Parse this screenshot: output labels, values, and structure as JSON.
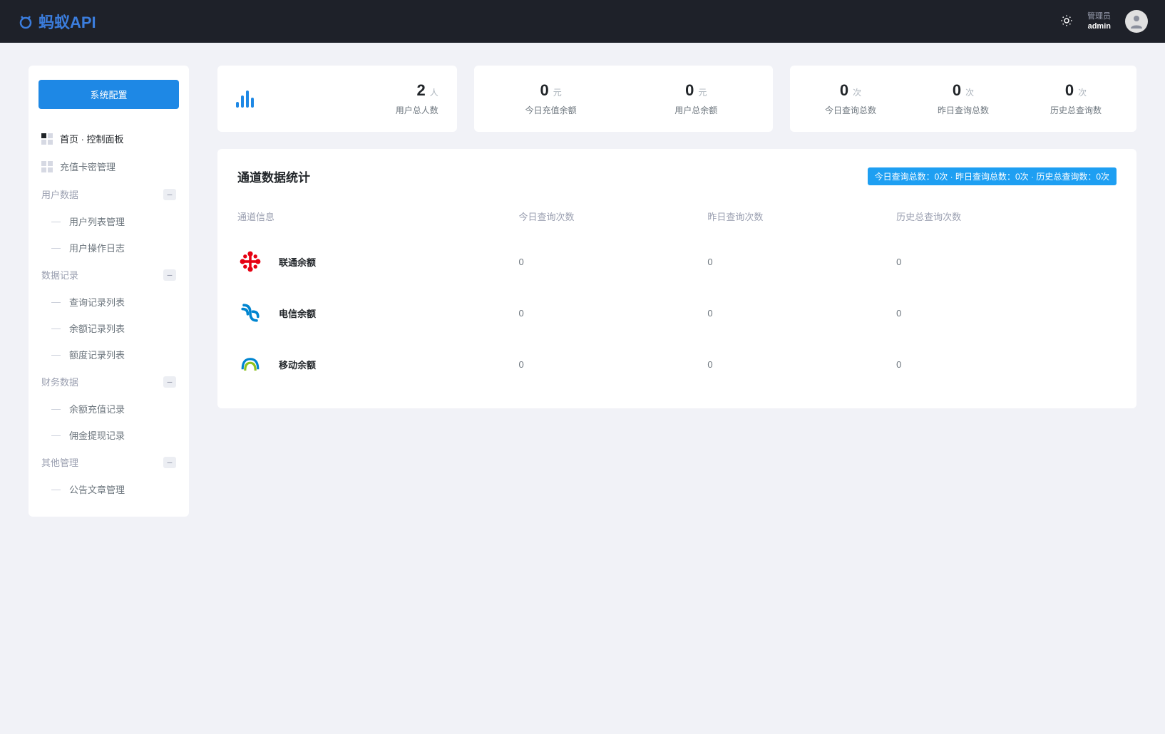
{
  "header": {
    "logo_text": "蚂蚁API",
    "user_role": "管理员",
    "user_name": "admin"
  },
  "sidebar": {
    "config_button": "系统配置",
    "items": [
      {
        "label": "首页 · 控制面板",
        "active": true
      },
      {
        "label": "充值卡密管理",
        "active": false
      }
    ],
    "groups": [
      {
        "title": "用户数据",
        "items": [
          "用户列表管理",
          "用户操作日志"
        ]
      },
      {
        "title": "数据记录",
        "items": [
          "查询记录列表",
          "余额记录列表",
          "额度记录列表"
        ]
      },
      {
        "title": "财务数据",
        "items": [
          "余额充值记录",
          "佣金提现记录"
        ]
      },
      {
        "title": "其他管理",
        "items": [
          "公告文章管理"
        ]
      }
    ]
  },
  "stats": {
    "card1": {
      "value": "2",
      "unit": "人",
      "label": "用户总人数"
    },
    "card2": [
      {
        "value": "0",
        "unit": "元",
        "label": "今日充值余额"
      },
      {
        "value": "0",
        "unit": "元",
        "label": "用户总余额"
      }
    ],
    "card3": [
      {
        "value": "0",
        "unit": "次",
        "label": "今日查询总数"
      },
      {
        "value": "0",
        "unit": "次",
        "label": "昨日查询总数"
      },
      {
        "value": "0",
        "unit": "次",
        "label": "历史总查询数"
      }
    ]
  },
  "panel": {
    "title": "通道数据统计",
    "badge": "今日查询总数：0次 · 昨日查询总数：0次 · 历史总查询数：0次",
    "columns": [
      "通道信息",
      "今日查询次数",
      "昨日查询次数",
      "历史总查询次数"
    ],
    "rows": [
      {
        "name": "联通余额",
        "today": "0",
        "yesterday": "0",
        "total": "0",
        "carrier": "unicom"
      },
      {
        "name": "电信余额",
        "today": "0",
        "yesterday": "0",
        "total": "0",
        "carrier": "telecom"
      },
      {
        "name": "移动余额",
        "today": "0",
        "yesterday": "0",
        "total": "0",
        "carrier": "mobile"
      }
    ]
  }
}
